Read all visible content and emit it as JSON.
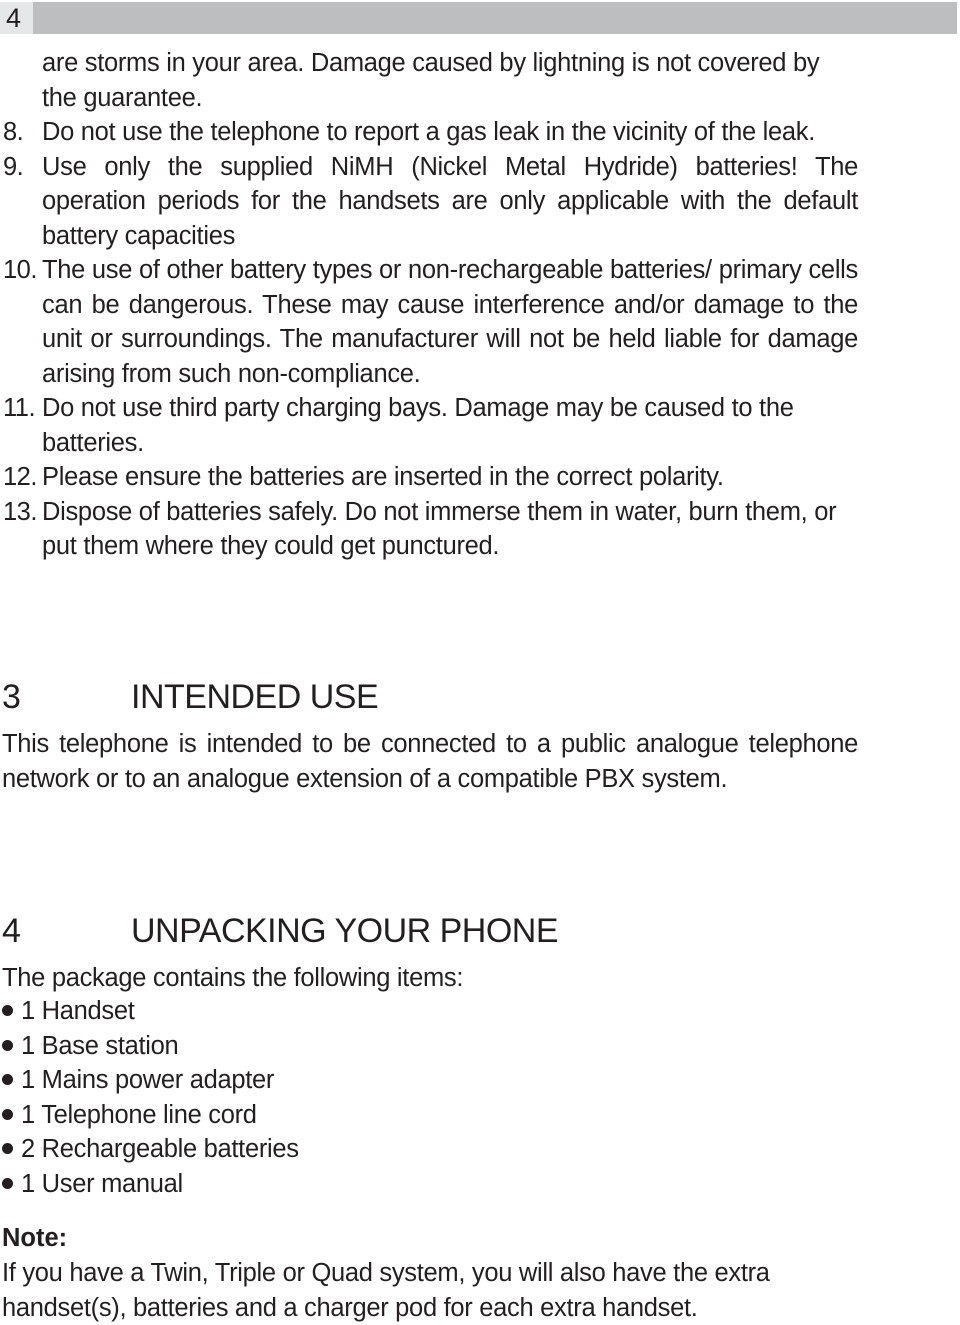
{
  "header": {
    "page_number": "4"
  },
  "continued_text": "are storms in your area. Damage caused by lightning is not covered by the guarantee.",
  "safety_items": [
    {
      "number": "8.",
      "text": "Do not use the telephone to report a gas leak in the vicinity of the leak."
    },
    {
      "number": "9.",
      "text": "Use only the supplied NiMH (Nickel Metal Hydride) batteries! The operation periods for the handsets are only applicable with the default battery capacities"
    },
    {
      "number": "10.",
      "text": "The use of other battery types or non-rechargeable batteries/ primary cells can be dangerous. These may cause interference and/or damage to the unit or surroundings. The manufacturer will not be held liable for damage arising from such non-compliance."
    },
    {
      "number": "11.",
      "text": "Do not use third party charging bays. Damage may be caused to the batteries."
    },
    {
      "number": "12.",
      "text": "Please ensure the batteries are inserted in the correct polarity."
    },
    {
      "number": "13.",
      "text": "Dispose of batteries safely. Do not immerse them in water, burn them, or put them where they could get punctured."
    }
  ],
  "sections": [
    {
      "number": "3",
      "title": "INTENDED USE",
      "body": "This telephone is intended to be connected to a public analogue telephone network or to an analogue extension of a compatible PBX system."
    },
    {
      "number": "4",
      "title": "UNPACKING YOUR PHONE",
      "body": "The package contains the following items:",
      "items": [
        "1 Handset",
        "1 Base station",
        "1 Mains power adapter",
        "1 Telephone line cord",
        "2 Rechargeable batteries",
        "1 User manual"
      ]
    }
  ],
  "note": {
    "label": "Note:",
    "text": "If you have a Twin, Triple or Quad system, you will also have the extra handset(s), batteries and a charger pod for each extra handset."
  }
}
